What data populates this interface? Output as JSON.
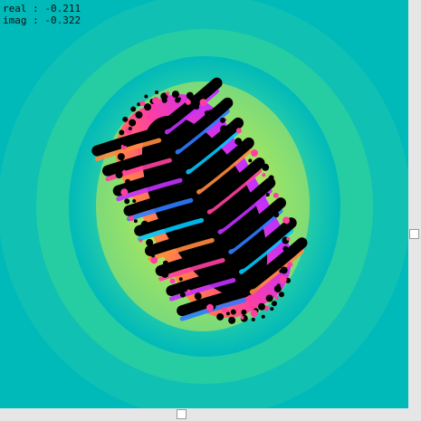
{
  "readout": {
    "real_label": "real",
    "real_value": "-0.211",
    "imag_label": "imag",
    "imag_value": "-0.322",
    "real_text": "real : -0.211",
    "imag_text": "imag : -0.322"
  },
  "fractal": {
    "type": "julia-set",
    "c_real": -0.211,
    "c_imag": -0.322,
    "colors": {
      "background": "#00b9b9",
      "ring_1": "#16c7b0",
      "ring_2": "#35d69e",
      "ring_3": "#7ee06a",
      "ring_4": "#b3e855",
      "set_interior": "#000000",
      "band_orange": "#ff8a3d",
      "band_pink": "#ff3fa0",
      "band_magenta": "#c230ff",
      "band_blue": "#2f7bff",
      "band_cyan": "#00c8ff"
    }
  },
  "scrollbars": {
    "vertical_position": 0.56,
    "horizontal_position": 0.44
  }
}
